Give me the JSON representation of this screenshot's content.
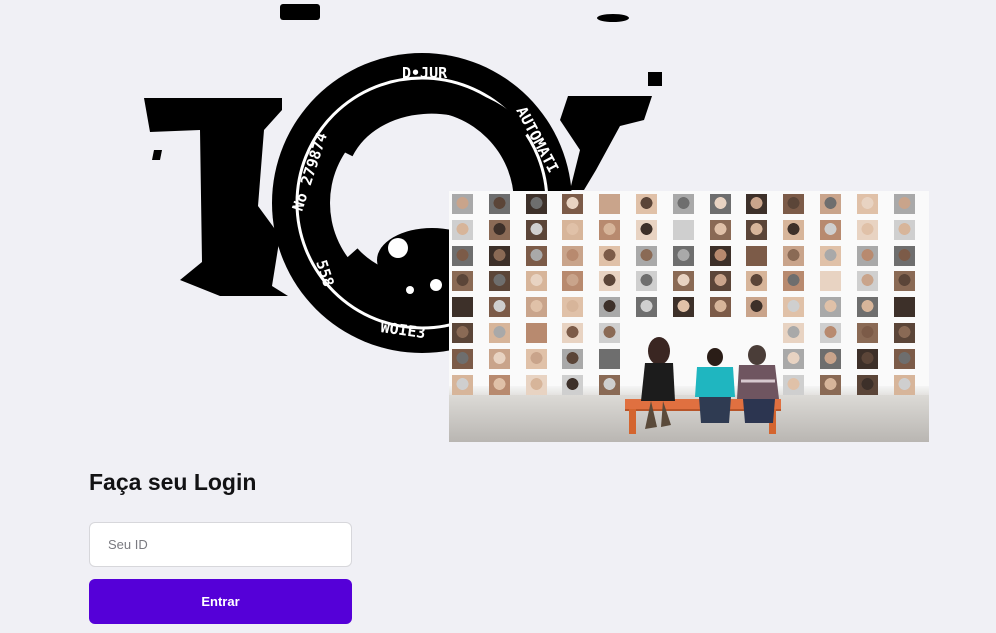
{
  "logo": {
    "ring_text_top": "D•JUR",
    "ring_text_right": "AUTOMATI",
    "ring_text_left": "No 279874",
    "ring_text_bottom_left": "558",
    "ring_text_bottom": "WOIE3"
  },
  "login": {
    "title": "Faça seu Login",
    "id_placeholder": "Seu ID",
    "id_value": "",
    "submit_label": "Entrar"
  },
  "colors": {
    "background": "#f0f0f5",
    "primary": "#5500d8",
    "title": "#121214",
    "bench": "#e07040"
  }
}
